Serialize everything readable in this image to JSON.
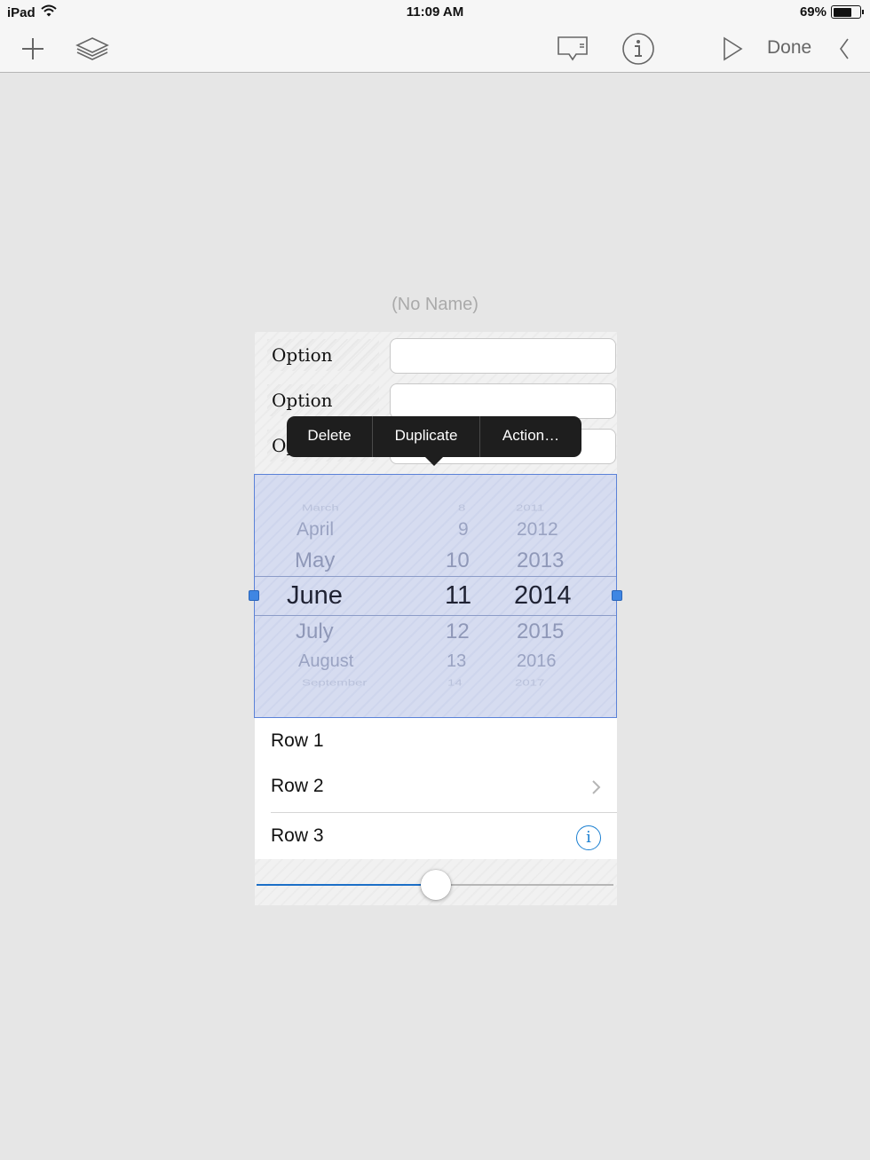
{
  "status_bar": {
    "device": "iPad",
    "time": "11:09 AM",
    "battery_percent": "69%",
    "battery_level": 0.69,
    "icons": [
      "wifi-icon",
      "battery-icon"
    ]
  },
  "toolbar": {
    "icons": [
      "plus-icon",
      "layers-icon",
      "comment-icon",
      "info-icon",
      "play-icon",
      "back-chevron-icon"
    ],
    "done_label": "Done"
  },
  "document": {
    "title": "(No Name)"
  },
  "options": [
    {
      "label": "Option",
      "value": ""
    },
    {
      "label": "Option",
      "value": ""
    },
    {
      "label": "Option",
      "value": ""
    }
  ],
  "context_menu": {
    "items": [
      "Delete",
      "Duplicate",
      "Action…"
    ]
  },
  "date_picker": {
    "months": [
      "March",
      "April",
      "May",
      "June",
      "July",
      "August",
      "September"
    ],
    "days": [
      "8",
      "9",
      "10",
      "11",
      "12",
      "13",
      "14"
    ],
    "years": [
      "2011",
      "2012",
      "2013",
      "2014",
      "2015",
      "2016",
      "2017"
    ],
    "selected": {
      "month": "June",
      "day": "11",
      "year": "2014"
    }
  },
  "table": {
    "rows": [
      {
        "label": "Row 1",
        "accessory": "none"
      },
      {
        "label": "Row 2",
        "accessory": "chevron-right-icon"
      },
      {
        "label": "Row 3",
        "accessory": "info-icon"
      }
    ]
  },
  "slider": {
    "value": 0.5
  },
  "colors": {
    "accent": "#1c6fc7",
    "selection_border": "#5b82d8",
    "selection_fill": "#d6dcf0",
    "menu_background": "#1e1e1e"
  }
}
